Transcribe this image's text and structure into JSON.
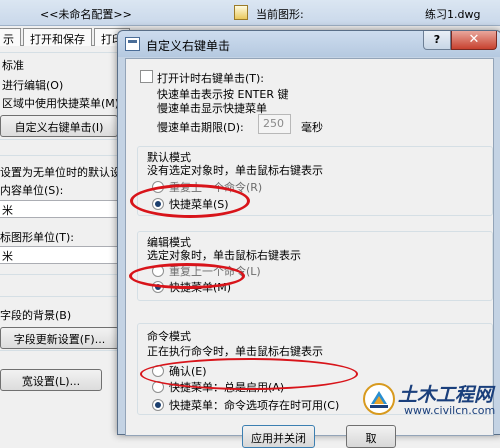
{
  "background": {
    "profile_label": "<<未命名配置>>",
    "current_drawing_label": "当前图形:",
    "current_drawing_value": "练习1.dwg",
    "tabs": [
      "示",
      "打开和保存",
      "打印"
    ],
    "standard_label": "标准",
    "dbl_click_edit": "进行编辑(O)",
    "shortcut_in_area": "区域中使用快捷菜单(M)",
    "right_click_btn": "自定义右键单击(I)",
    "units_heading": "设置为无单位时的默认设",
    "source_units_label": "内容单位(S):",
    "source_units_value": "米",
    "target_units_label": "标图形单位(T):",
    "target_units_value": "米",
    "field_bg_label": "字段的背景(B)",
    "field_update_btn": "字段更新设置(F)...",
    "lineweight_btn": "宽设置(L)..."
  },
  "dialog": {
    "title": "自定义右键单击",
    "help_label": "?",
    "close_label": "✕",
    "timesensitive": {
      "checkbox_label": "打开计时右键单击(T):",
      "checked": false,
      "quick_click_line": "快速单击表示按 ENTER 键",
      "slow_click_line": "慢速单击显示快捷菜单",
      "duration_label": "慢速单击期限(D):",
      "duration_value": "250",
      "duration_unit": "毫秒"
    },
    "default_mode": {
      "title": "默认模式",
      "description": "没有选定对象时，单击鼠标右键表示",
      "options": [
        "重复上一个命令(R)",
        "快捷菜单(S)"
      ],
      "selected": "快捷菜单(S)"
    },
    "edit_mode": {
      "title": "编辑模式",
      "description": "选定对象时，单击鼠标右键表示",
      "options": [
        "重复上一个命令(L)",
        "快捷菜单(M)"
      ],
      "selected": "快捷菜单(M)"
    },
    "command_mode": {
      "title": "命令模式",
      "description": "正在执行命令时，单击鼠标右键表示",
      "options": [
        "确认(E)",
        "快捷菜单：总是启用(A)",
        "快捷菜单：命令选项存在时可用(C)"
      ],
      "selected": "快捷菜单：命令选项存在时可用(C)"
    },
    "apply_close_label": "应用并关闭",
    "cancel_label": "取"
  },
  "watermark": {
    "title": "土木工程网",
    "url": "www.civilcn.com"
  },
  "colors": {
    "highlight_oval": "#d8141a",
    "title_gradient_top": "#cddcee",
    "close_button": "#c7412f"
  }
}
